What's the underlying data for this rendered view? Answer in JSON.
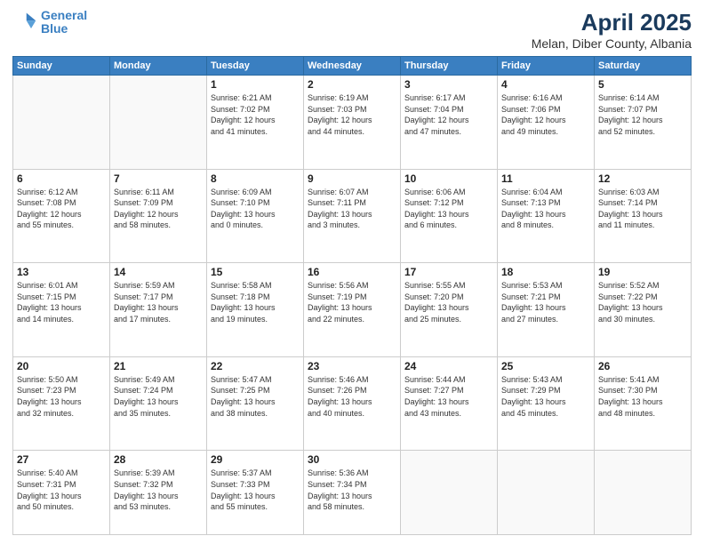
{
  "header": {
    "logo_line1": "General",
    "logo_line2": "Blue",
    "month": "April 2025",
    "location": "Melan, Diber County, Albania"
  },
  "weekdays": [
    "Sunday",
    "Monday",
    "Tuesday",
    "Wednesday",
    "Thursday",
    "Friday",
    "Saturday"
  ],
  "weeks": [
    [
      {
        "day": "",
        "info": ""
      },
      {
        "day": "",
        "info": ""
      },
      {
        "day": "1",
        "info": "Sunrise: 6:21 AM\nSunset: 7:02 PM\nDaylight: 12 hours\nand 41 minutes."
      },
      {
        "day": "2",
        "info": "Sunrise: 6:19 AM\nSunset: 7:03 PM\nDaylight: 12 hours\nand 44 minutes."
      },
      {
        "day": "3",
        "info": "Sunrise: 6:17 AM\nSunset: 7:04 PM\nDaylight: 12 hours\nand 47 minutes."
      },
      {
        "day": "4",
        "info": "Sunrise: 6:16 AM\nSunset: 7:06 PM\nDaylight: 12 hours\nand 49 minutes."
      },
      {
        "day": "5",
        "info": "Sunrise: 6:14 AM\nSunset: 7:07 PM\nDaylight: 12 hours\nand 52 minutes."
      }
    ],
    [
      {
        "day": "6",
        "info": "Sunrise: 6:12 AM\nSunset: 7:08 PM\nDaylight: 12 hours\nand 55 minutes."
      },
      {
        "day": "7",
        "info": "Sunrise: 6:11 AM\nSunset: 7:09 PM\nDaylight: 12 hours\nand 58 minutes."
      },
      {
        "day": "8",
        "info": "Sunrise: 6:09 AM\nSunset: 7:10 PM\nDaylight: 13 hours\nand 0 minutes."
      },
      {
        "day": "9",
        "info": "Sunrise: 6:07 AM\nSunset: 7:11 PM\nDaylight: 13 hours\nand 3 minutes."
      },
      {
        "day": "10",
        "info": "Sunrise: 6:06 AM\nSunset: 7:12 PM\nDaylight: 13 hours\nand 6 minutes."
      },
      {
        "day": "11",
        "info": "Sunrise: 6:04 AM\nSunset: 7:13 PM\nDaylight: 13 hours\nand 8 minutes."
      },
      {
        "day": "12",
        "info": "Sunrise: 6:03 AM\nSunset: 7:14 PM\nDaylight: 13 hours\nand 11 minutes."
      }
    ],
    [
      {
        "day": "13",
        "info": "Sunrise: 6:01 AM\nSunset: 7:15 PM\nDaylight: 13 hours\nand 14 minutes."
      },
      {
        "day": "14",
        "info": "Sunrise: 5:59 AM\nSunset: 7:17 PM\nDaylight: 13 hours\nand 17 minutes."
      },
      {
        "day": "15",
        "info": "Sunrise: 5:58 AM\nSunset: 7:18 PM\nDaylight: 13 hours\nand 19 minutes."
      },
      {
        "day": "16",
        "info": "Sunrise: 5:56 AM\nSunset: 7:19 PM\nDaylight: 13 hours\nand 22 minutes."
      },
      {
        "day": "17",
        "info": "Sunrise: 5:55 AM\nSunset: 7:20 PM\nDaylight: 13 hours\nand 25 minutes."
      },
      {
        "day": "18",
        "info": "Sunrise: 5:53 AM\nSunset: 7:21 PM\nDaylight: 13 hours\nand 27 minutes."
      },
      {
        "day": "19",
        "info": "Sunrise: 5:52 AM\nSunset: 7:22 PM\nDaylight: 13 hours\nand 30 minutes."
      }
    ],
    [
      {
        "day": "20",
        "info": "Sunrise: 5:50 AM\nSunset: 7:23 PM\nDaylight: 13 hours\nand 32 minutes."
      },
      {
        "day": "21",
        "info": "Sunrise: 5:49 AM\nSunset: 7:24 PM\nDaylight: 13 hours\nand 35 minutes."
      },
      {
        "day": "22",
        "info": "Sunrise: 5:47 AM\nSunset: 7:25 PM\nDaylight: 13 hours\nand 38 minutes."
      },
      {
        "day": "23",
        "info": "Sunrise: 5:46 AM\nSunset: 7:26 PM\nDaylight: 13 hours\nand 40 minutes."
      },
      {
        "day": "24",
        "info": "Sunrise: 5:44 AM\nSunset: 7:27 PM\nDaylight: 13 hours\nand 43 minutes."
      },
      {
        "day": "25",
        "info": "Sunrise: 5:43 AM\nSunset: 7:29 PM\nDaylight: 13 hours\nand 45 minutes."
      },
      {
        "day": "26",
        "info": "Sunrise: 5:41 AM\nSunset: 7:30 PM\nDaylight: 13 hours\nand 48 minutes."
      }
    ],
    [
      {
        "day": "27",
        "info": "Sunrise: 5:40 AM\nSunset: 7:31 PM\nDaylight: 13 hours\nand 50 minutes."
      },
      {
        "day": "28",
        "info": "Sunrise: 5:39 AM\nSunset: 7:32 PM\nDaylight: 13 hours\nand 53 minutes."
      },
      {
        "day": "29",
        "info": "Sunrise: 5:37 AM\nSunset: 7:33 PM\nDaylight: 13 hours\nand 55 minutes."
      },
      {
        "day": "30",
        "info": "Sunrise: 5:36 AM\nSunset: 7:34 PM\nDaylight: 13 hours\nand 58 minutes."
      },
      {
        "day": "",
        "info": ""
      },
      {
        "day": "",
        "info": ""
      },
      {
        "day": "",
        "info": ""
      }
    ]
  ]
}
